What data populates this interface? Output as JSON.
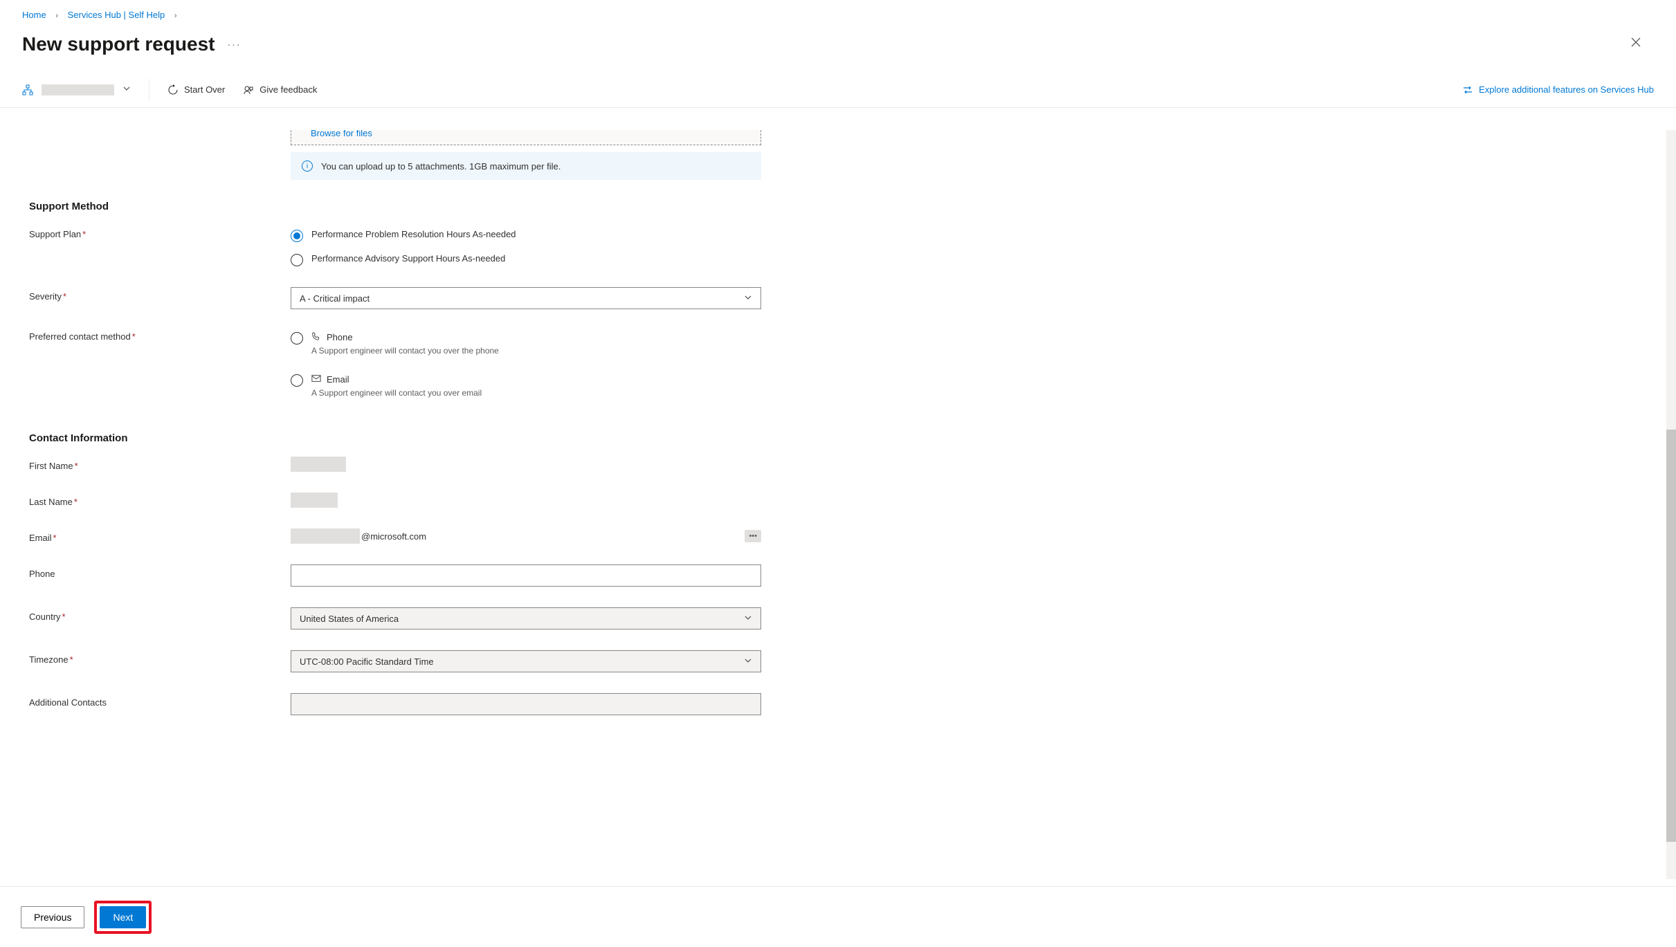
{
  "breadcrumb": {
    "home": "Home",
    "hub": "Services Hub | Self Help"
  },
  "page_title": "New support request",
  "toolbar": {
    "start_over": "Start Over",
    "give_feedback": "Give feedback",
    "explore": "Explore additional features on Services Hub"
  },
  "upload": {
    "browse": "Browse for files",
    "info": "You can upload up to 5 attachments. 1GB maximum per file."
  },
  "sections": {
    "support_method": "Support Method",
    "contact_info": "Contact Information"
  },
  "labels": {
    "support_plan": "Support Plan",
    "severity": "Severity",
    "preferred_contact": "Preferred contact method",
    "first_name": "First Name",
    "last_name": "Last Name",
    "email": "Email",
    "phone_field": "Phone",
    "country": "Country",
    "timezone": "Timezone",
    "additional_contacts": "Additional Contacts"
  },
  "support_plan_options": {
    "opt1": "Performance Problem Resolution Hours As-needed",
    "opt2": "Performance Advisory Support Hours As-needed"
  },
  "severity_value": "A - Critical impact",
  "contact_method": {
    "phone_label": "Phone",
    "phone_sub": "A Support engineer will contact you over the phone",
    "email_label": "Email",
    "email_sub": "A Support engineer will contact you over email"
  },
  "contact_values": {
    "email_suffix": "@microsoft.com",
    "country": "United States of America",
    "timezone": "UTC-08:00 Pacific Standard Time"
  },
  "footer": {
    "previous": "Previous",
    "next": "Next"
  }
}
